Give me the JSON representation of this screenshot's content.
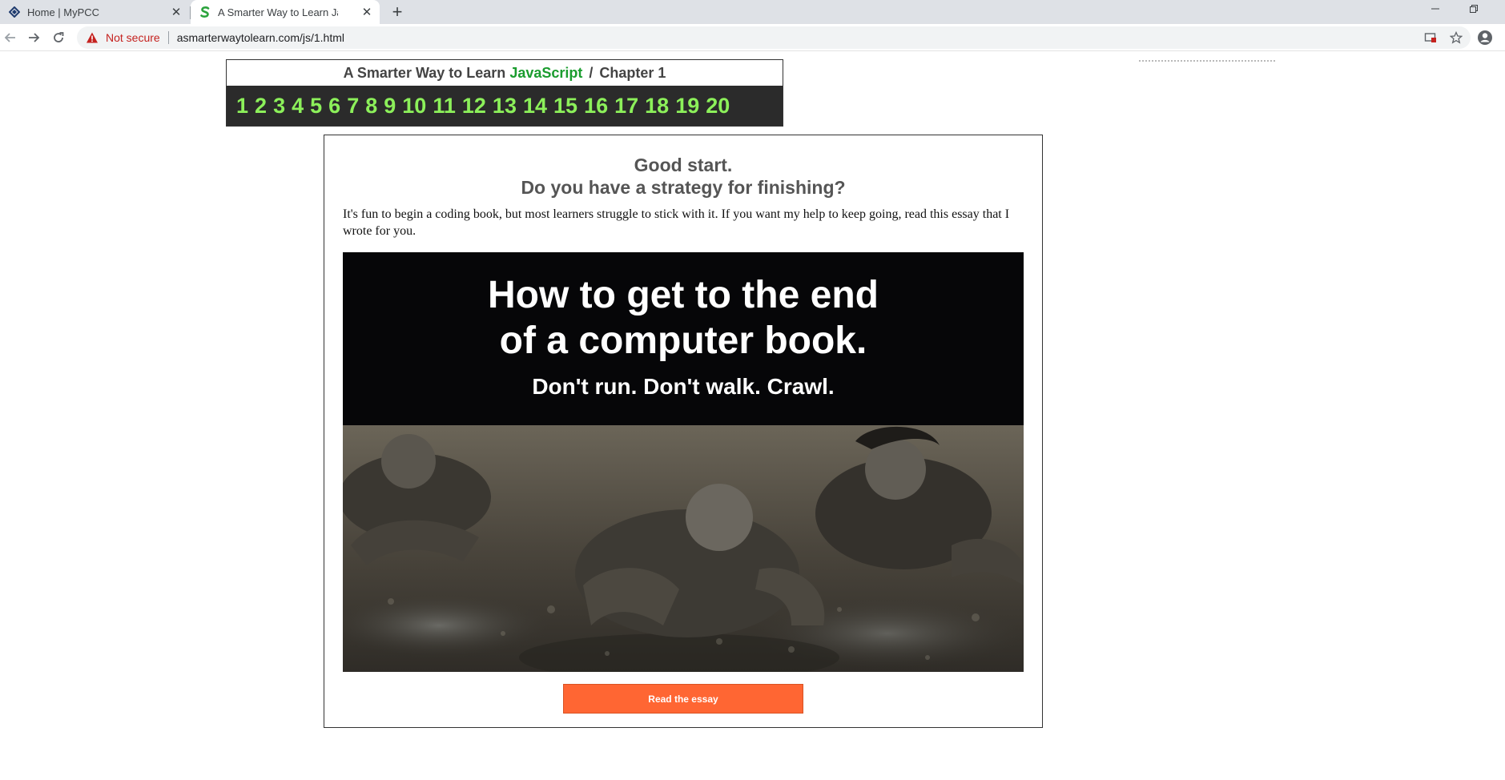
{
  "browser": {
    "tabs": [
      {
        "title": "Home | MyPCC",
        "icon": "mypcc-diamond-icon"
      },
      {
        "title": "A Smarter Way to Learn JavaScrip",
        "icon": "site-s-icon",
        "active": true
      }
    ],
    "security_label": "Not secure",
    "url": "asmarterwaytolearn.com/js/1.html"
  },
  "header": {
    "prefix": "A Smarter Way to Learn",
    "subject": "JavaScript",
    "separator": "/",
    "chapter": "Chapter 1",
    "chapters": [
      "1",
      "2",
      "3",
      "4",
      "5",
      "6",
      "7",
      "8",
      "9",
      "10",
      "11",
      "12",
      "13",
      "14",
      "15",
      "16",
      "17",
      "18",
      "19",
      "20"
    ]
  },
  "promo": {
    "heading_1": "Good start.",
    "heading_2": "Do you have a strategy for finishing?",
    "intro": "It's fun to begin a coding book, but most learners struggle to stick with it. If you want my help to keep going, read this essay that I wrote for you.",
    "banner_line_1": "How to get to the end",
    "banner_line_2": "of a computer book.",
    "banner_line_3": "Don't run. Don't walk. Crawl.",
    "button_label": "Read the essay"
  },
  "colors": {
    "accent_green": "#8cf05a",
    "title_green": "#1a9c2e",
    "button_orange": "#ff6633",
    "warning_red": "#c5221f"
  }
}
